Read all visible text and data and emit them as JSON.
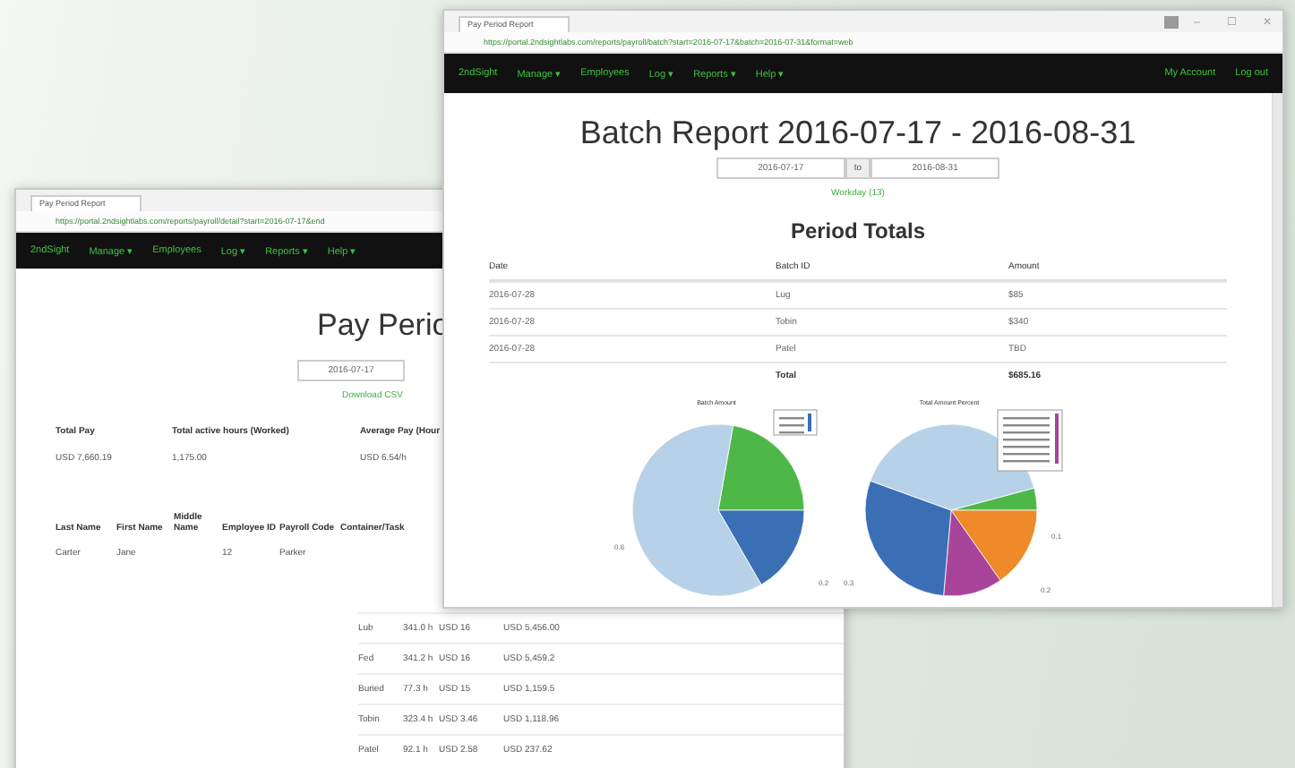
{
  "back_window": {
    "tab_title": "Pay Period Report",
    "url": "https://portal.2ndsightlabs.com/reports/payroll/detail?start=2016-07-17&end",
    "brand": "2ndSight",
    "nav_items": [
      "Manage ▾",
      "Employees",
      "Log ▾",
      "Reports ▾",
      "Help ▾"
    ],
    "title": "Pay Perio",
    "date_from": "2016-07-17",
    "link": "Download CSV",
    "summary": {
      "columns": [
        "Total Pay",
        "Total active hours (Worked)",
        "Average Pay (Hour"
      ],
      "values": [
        "USD 7,660.19",
        "1,175.00",
        "USD 6.54/h"
      ]
    },
    "employees": {
      "columns": [
        "Last Name",
        "First Name",
        "Middle Name",
        "Employee ID",
        "Payroll Code",
        "Container/Task"
      ],
      "row": {
        "last_name": "Carter",
        "first_name": "Jane",
        "employee_id": "12",
        "payroll_code": "Parker"
      },
      "tasks": [
        {
          "name": "Lub",
          "hours": "341.0 h",
          "rate": "USD 16",
          "total": "USD 5,456.00"
        },
        {
          "name": "Fed",
          "hours": "341.2 h",
          "rate": "USD 16",
          "total": "USD 5,459.2"
        },
        {
          "name": "Buried",
          "hours": "77.3 h",
          "rate": "USD 15",
          "total": "USD 1,159.5"
        },
        {
          "name": "Tobin",
          "hours": "323.4 h",
          "rate": "USD 3.46",
          "total": "USD 1,118.96"
        },
        {
          "name": "Patel",
          "hours": "92.1 h",
          "rate": "USD 2.58",
          "total": "USD 237.62"
        }
      ]
    }
  },
  "front_window": {
    "tab_title": "Pay Period Report",
    "url": "https://portal.2ndsightlabs.com/reports/payroll/batch?start=2016-07-17&batch=2016-07-31&format=web",
    "window_controls": [
      "–",
      "☐",
      "✕"
    ],
    "brand": "2ndSight",
    "nav_items": [
      "Manage ▾",
      "Employees",
      "Log ▾",
      "Reports ▾",
      "Help ▾"
    ],
    "nav_right": [
      "My Account",
      "Log out"
    ],
    "title": "Batch Report 2016-07-17 - 2016-08-31",
    "date_from": "2016-07-17",
    "date_to_label": "to",
    "date_to": "2016-08-31",
    "link": "Workday (13)",
    "section_title": "Period Totals",
    "table": {
      "columns": [
        "Date",
        "Batch ID",
        "Amount"
      ],
      "rows": [
        [
          "2016-07-28",
          "Lug",
          "$85"
        ],
        [
          "2016-07-28",
          "Tobin",
          "$340"
        ],
        [
          "2016-07-28",
          "Patel",
          "TBD"
        ]
      ],
      "total": {
        "label": "Total",
        "amount": "$685.16"
      }
    },
    "charts": [
      {
        "title": "Batch Amount",
        "labels": [
          "0.6",
          "0.2"
        ]
      },
      {
        "title": "Total Amount Percent",
        "labels": [
          "0.3",
          "0.1",
          "0.2"
        ]
      }
    ]
  }
}
